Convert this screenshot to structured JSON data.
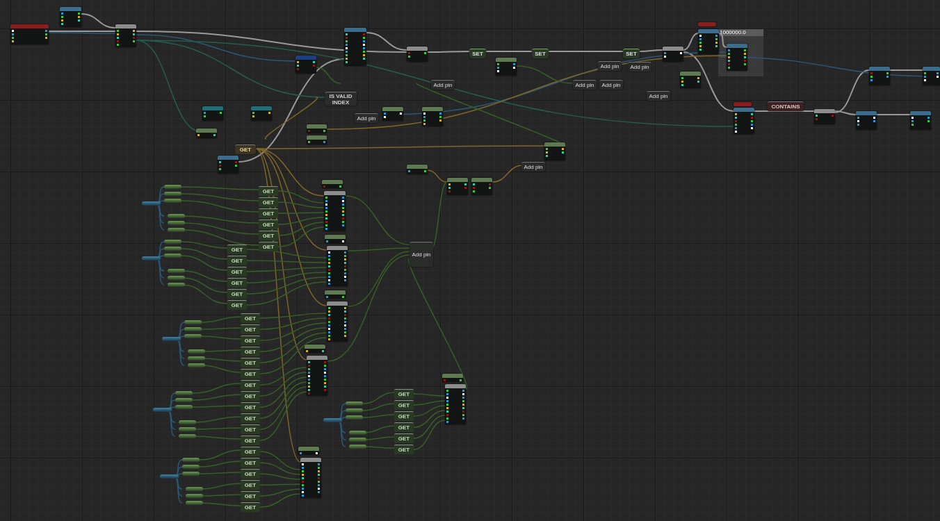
{
  "graph": {
    "comment": {
      "title": "1000000.0"
    },
    "function_nodes": [
      {
        "color": "#8a1d1d"
      },
      {
        "color": "#3d6d8c"
      },
      {
        "color": "#8c8c8c"
      },
      {
        "color": "#1c3f82"
      },
      {
        "color": "#3d6d8c"
      },
      {
        "color": "#8c8c8c"
      },
      {
        "color": "#5d7a50"
      },
      {
        "color": "#8c8c8c"
      },
      {
        "color": "#3d6d8c"
      },
      {
        "color": "#3d6d8c"
      },
      {
        "color": "#5d7a50"
      },
      {
        "color": "#3d6d8c"
      },
      {
        "color": "#8c8c8c"
      },
      {
        "color": "#3d6d8c"
      },
      {
        "color": "#3d6d8c"
      },
      {
        "color": "#3d6d8c"
      },
      {
        "color": "#3d6d8c"
      },
      {
        "color": "#1f6f78"
      },
      {
        "color": "#1f6f78"
      },
      {
        "color": "#5d7a50"
      },
      {
        "color": "#3d6d8c"
      },
      {
        "color": "#5d7a50"
      },
      {
        "color": "#5d7a50"
      },
      {
        "color": "#5d7a50"
      },
      {
        "color": "#5d7a50"
      },
      {
        "color": "#5d7a50"
      },
      {
        "color": "#5d7a50"
      },
      {
        "color": "#5d7a50"
      },
      {
        "color": "#5d7a50"
      },
      {
        "color": "#5d7a50"
      },
      {
        "color": "#8c8c8c"
      },
      {
        "color": "#5d7a50"
      },
      {
        "color": "#8c8c8c"
      },
      {
        "color": "#5d7a50"
      },
      {
        "color": "#8c8c8c"
      },
      {
        "color": "#5d7a50"
      },
      {
        "color": "#8c8c8c"
      },
      {
        "color": "#5d7a50"
      },
      {
        "color": "#8c8c8c"
      },
      {
        "color": "#5d7a50"
      },
      {
        "color": "#8c8c8c"
      },
      {
        "color": "#8a1d1d"
      },
      {
        "color": "#8a1d1d"
      }
    ],
    "compact_nodes": [
      {
        "kind": "set",
        "label": "SET"
      },
      {
        "kind": "set",
        "label": "SET"
      },
      {
        "kind": "set",
        "label": "SET"
      },
      {
        "kind": "add_pin",
        "label": "Add pin"
      },
      {
        "kind": "add_pin",
        "label": "Add pin"
      },
      {
        "kind": "add_pin",
        "label": "Add pin"
      },
      {
        "kind": "add_pin",
        "label": "Add pin"
      },
      {
        "kind": "add_pin",
        "label": "Add pin"
      },
      {
        "kind": "add_pin",
        "label": "Add pin"
      },
      {
        "kind": "add_pin",
        "label": "Add pin"
      },
      {
        "kind": "add_pin",
        "label": "Add pin"
      },
      {
        "kind": "add_pin",
        "label": "Add pin"
      },
      {
        "kind": "is_valid",
        "label": "IS VALID INDEX"
      },
      {
        "kind": "contains",
        "label": "CONTAINS"
      },
      {
        "kind": "get_ref",
        "label": "GET"
      }
    ],
    "get_groups": [
      {
        "items": [
          "GET",
          "GET",
          "GET",
          "GET",
          "GET",
          "GET"
        ]
      },
      {
        "items": [
          "GET",
          "GET",
          "GET",
          "GET",
          "GET",
          "GET"
        ]
      },
      {
        "items": [
          "GET",
          "GET",
          "GET",
          "GET",
          "GET",
          "GET",
          "GET",
          "GET",
          "GET",
          "GET",
          "GET",
          "GET",
          "GET",
          "GET",
          "GET",
          "GET",
          "GET",
          "GET"
        ]
      },
      {
        "items": [
          "GET",
          "GET",
          "GET",
          "GET",
          "GET",
          "GET"
        ]
      }
    ]
  }
}
